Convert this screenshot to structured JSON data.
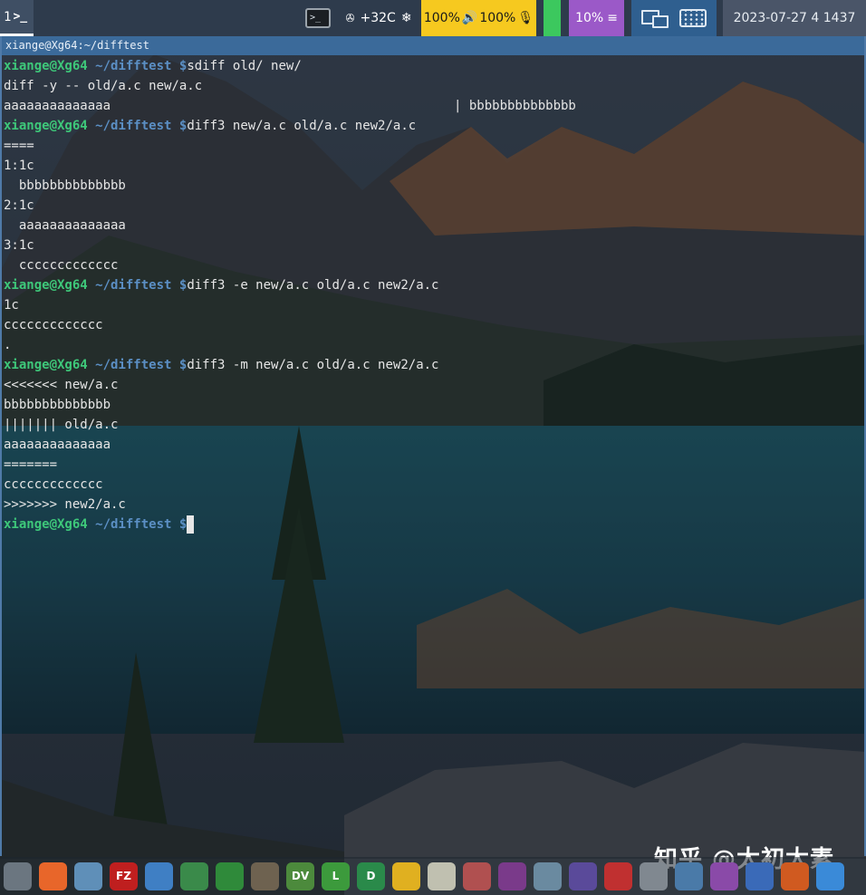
{
  "panel": {
    "workspace": "1",
    "workspace_icon": "terminal-prompt-icon",
    "weather": {
      "icon": "fan-icon",
      "temperature": "+32C",
      "status_icon": "snowflake-icon"
    },
    "audio": {
      "speaker_volume": "100%",
      "speaker_icon": "speaker-icon",
      "mic_volume": "100%",
      "mic_icon": "microphone-icon"
    },
    "cpu": {
      "value": "10%",
      "icon": "menu-icon"
    },
    "clock": "2023-07-27 4 1437",
    "colors": {
      "audio": "#f6c91f",
      "status_green": "#3cc85e",
      "cpu": "#9b59c8",
      "network": "#2f5f8f",
      "clock": "#4a5568"
    }
  },
  "terminal": {
    "title": "xiange@Xg64:~/difftest",
    "prompt": {
      "user": "xiange@Xg64",
      "path": "~/difftest",
      "dollar": "$"
    },
    "lines": [
      {
        "type": "prompt",
        "cmd": "sdiff old/ new/"
      },
      {
        "type": "out",
        "text": "diff -y -- old/a.c new/a.c"
      },
      {
        "type": "out",
        "text": "aaaaaaaaaaaaaa",
        "right": "| bbbbbbbbbbbbbb"
      },
      {
        "type": "prompt",
        "cmd": "diff3 new/a.c old/a.c new2/a.c"
      },
      {
        "type": "out",
        "text": "===="
      },
      {
        "type": "out",
        "text": "1:1c"
      },
      {
        "type": "out",
        "text": "  bbbbbbbbbbbbbb"
      },
      {
        "type": "out",
        "text": "2:1c"
      },
      {
        "type": "out",
        "text": "  aaaaaaaaaaaaaa"
      },
      {
        "type": "out",
        "text": "3:1c"
      },
      {
        "type": "out",
        "text": "  ccccccccccccc"
      },
      {
        "type": "prompt",
        "cmd": "diff3 -e new/a.c old/a.c new2/a.c"
      },
      {
        "type": "out",
        "text": "1c"
      },
      {
        "type": "out",
        "text": "ccccccccccccc"
      },
      {
        "type": "out",
        "text": "."
      },
      {
        "type": "prompt",
        "cmd": "diff3 -m new/a.c old/a.c new2/a.c"
      },
      {
        "type": "out",
        "text": "<<<<<<< new/a.c"
      },
      {
        "type": "out",
        "text": "bbbbbbbbbbbbbb"
      },
      {
        "type": "out",
        "text": "||||||| old/a.c"
      },
      {
        "type": "out",
        "text": "aaaaaaaaaaaaaa"
      },
      {
        "type": "out",
        "text": "======="
      },
      {
        "type": "out",
        "text": "ccccccccccccc"
      },
      {
        "type": "out",
        "text": ">>>>>>> new2/a.c"
      },
      {
        "type": "prompt",
        "cmd": "",
        "cursor": true
      }
    ]
  },
  "watermark": "知乎 @太初太素",
  "dock": [
    {
      "name": "file-manager-icon",
      "label": "",
      "color": "#6b7680"
    },
    {
      "name": "firefox-icon",
      "label": "",
      "color": "#e8662a"
    },
    {
      "name": "messenger-icon",
      "label": "",
      "color": "#5f8fb8"
    },
    {
      "name": "filezilla-icon",
      "label": "FZ",
      "color": "#bf1f1f"
    },
    {
      "name": "shark-fin-icon",
      "label": "",
      "color": "#3f7fc4"
    },
    {
      "name": "puzzle-icon",
      "label": "",
      "color": "#3a8a4a"
    },
    {
      "name": "leaf-icon",
      "label": "",
      "color": "#2f8a3a"
    },
    {
      "name": "gimp-icon",
      "label": "",
      "color": "#6e6250"
    },
    {
      "name": "dv-icon",
      "label": "DV",
      "color": "#4c8a3c"
    },
    {
      "name": "libreoffice-l-icon",
      "label": "L",
      "color": "#3c9a3c"
    },
    {
      "name": "libreoffice-d-icon",
      "label": "D",
      "color": "#2a8a4a"
    },
    {
      "name": "chart-pie-icon",
      "label": "",
      "color": "#e0b020"
    },
    {
      "name": "disc-icon",
      "label": "",
      "color": "#c0c0b0"
    },
    {
      "name": "document-viewer-icon",
      "label": "",
      "color": "#b05050"
    },
    {
      "name": "math-formula-icon",
      "label": "",
      "color": "#7a3a8a"
    },
    {
      "name": "magnifier-icon",
      "label": "",
      "color": "#6a8aa0"
    },
    {
      "name": "network-tool-icon",
      "label": "",
      "color": "#5a4a9a"
    },
    {
      "name": "downloader-icon",
      "label": "",
      "color": "#c03030"
    },
    {
      "name": "settings-gear-icon",
      "label": "",
      "color": "#808890"
    },
    {
      "name": "remote-desktop-icon",
      "label": "",
      "color": "#4a7aa8"
    },
    {
      "name": "notes-icon",
      "label": "",
      "color": "#8a4aa8"
    },
    {
      "name": "ide-icon",
      "label": "",
      "color": "#3a6ab8"
    },
    {
      "name": "fire-icon",
      "label": "",
      "color": "#d05a20"
    },
    {
      "name": "info-icon",
      "label": "",
      "color": "#3a8ad8"
    }
  ]
}
